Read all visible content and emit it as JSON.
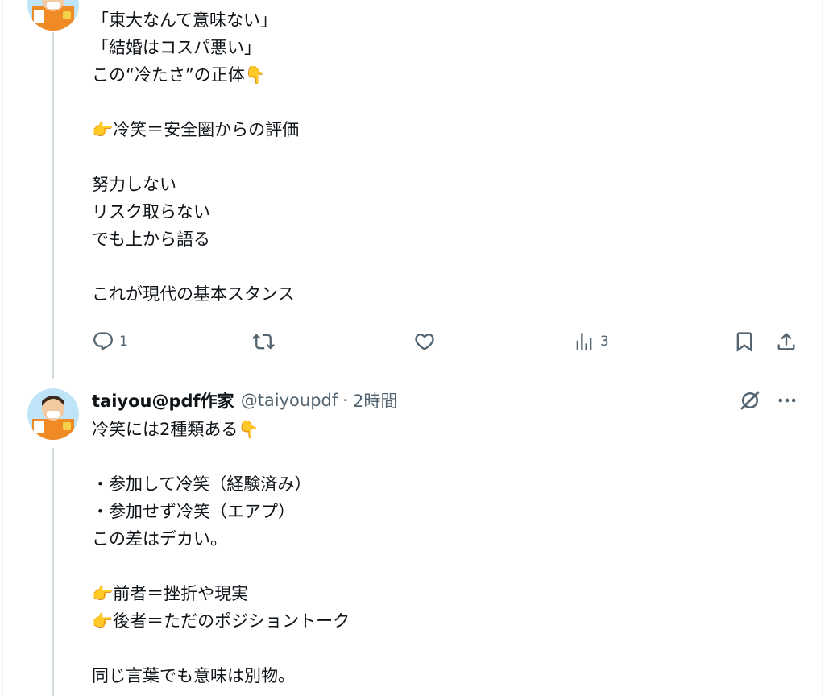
{
  "tweet1": {
    "text": "「東大なんて意味ない」\n「結婚はコスパ悪い」\nこの“冷たさ”の正体👇\n\n👉冷笑＝安全圏からの評価\n\n努力しない\nリスク取らない\nでも上から語る\n\nこれが現代の基本スタンス",
    "reply_count": "1",
    "retweet_count": "",
    "like_count": "",
    "views_count": "3"
  },
  "tweet2": {
    "author_name": "taiyou@pdf作家",
    "author_handle": "@taiyoupdf",
    "separator": "·",
    "time": "2時間",
    "text": "冷笑には2種類ある👇\n\n・参加して冷笑（経験済み）\n・参加せず冷笑（エアプ）\nこの差はデカい。\n\n👉前者＝挫折や現実\n👉後者＝ただのポジショントーク\n\n同じ言葉でも意味は別物。"
  },
  "icons": {
    "reply": "reply-icon",
    "retweet": "retweet-icon",
    "like": "heart-icon",
    "views": "views-chart-icon",
    "bookmark": "bookmark-icon",
    "share": "share-icon",
    "grok": "grok-icon",
    "more": "more-dots-icon"
  },
  "colors": {
    "text": "#0f1419",
    "muted": "#536471",
    "thread_line": "#cfd9de"
  }
}
